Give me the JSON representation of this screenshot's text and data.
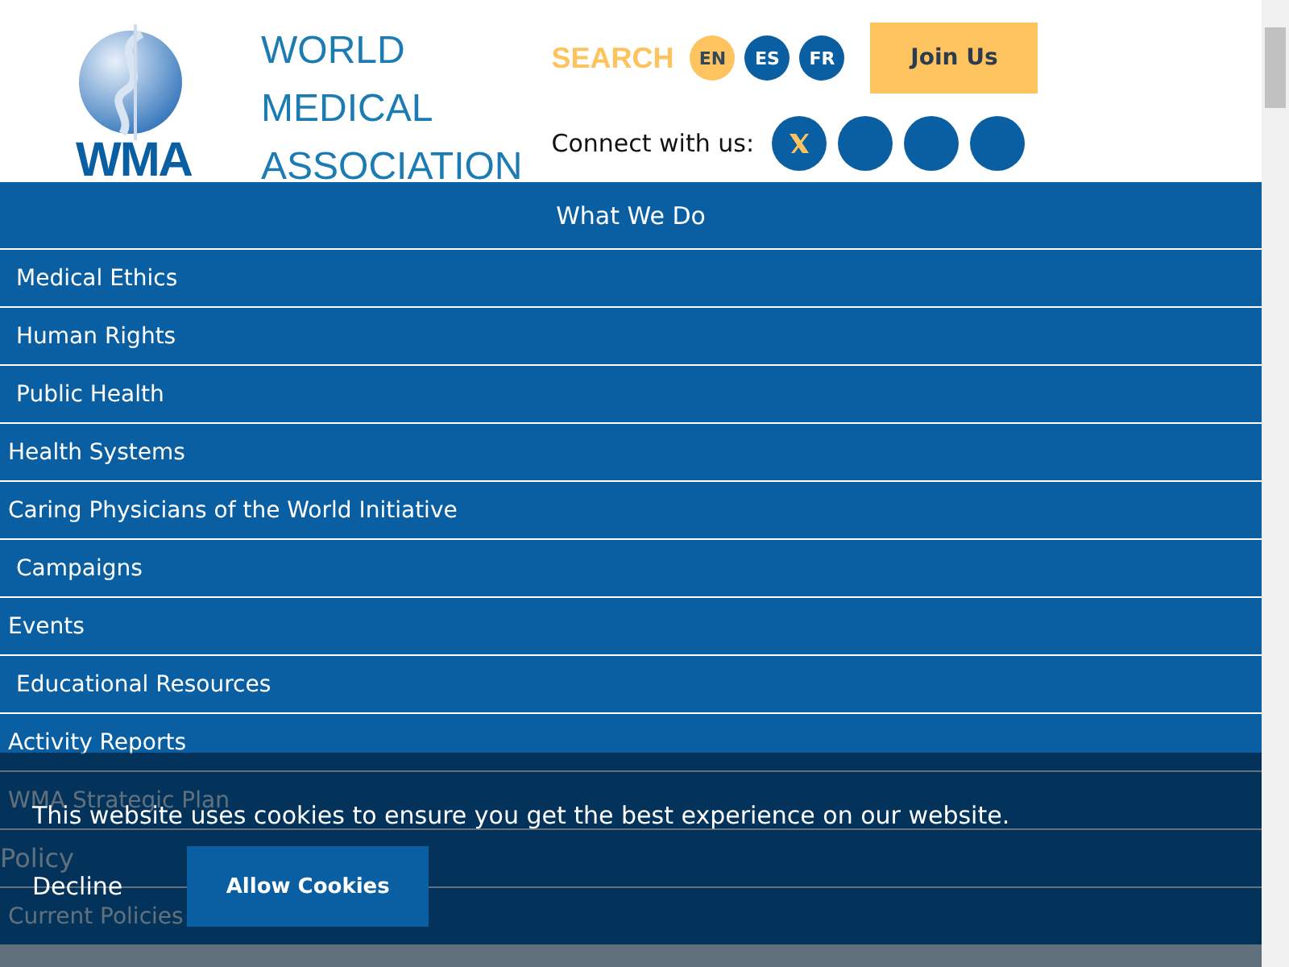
{
  "header": {
    "logo_mark": "WMA",
    "org_name": [
      "WORLD",
      "MEDICAL",
      "ASSOCIATION"
    ],
    "search_label": "SEARCH",
    "languages": [
      {
        "label": "EN",
        "selected": true
      },
      {
        "label": "ES",
        "selected": false
      },
      {
        "label": "FR",
        "selected": false
      }
    ],
    "join_button": "Join Us",
    "connect_label": "Connect with us:",
    "social": [
      {
        "kind": "x"
      },
      {
        "kind": "blank"
      },
      {
        "kind": "blank"
      },
      {
        "kind": "blank"
      }
    ]
  },
  "menu": {
    "title": "What We Do",
    "items": [
      {
        "label": "Medical Ethics",
        "kind": "sub"
      },
      {
        "label": "Human Rights",
        "kind": "sub"
      },
      {
        "label": "Public Health",
        "kind": "sub"
      },
      {
        "label": "Health Systems",
        "kind": "link"
      },
      {
        "label": "Caring Physicians of the World Initiative",
        "kind": "link"
      },
      {
        "label": "Campaigns",
        "kind": "sub"
      },
      {
        "label": "Events",
        "kind": "link"
      },
      {
        "label": "Educational Resources",
        "kind": "sub"
      },
      {
        "label": "Activity Reports",
        "kind": "link"
      },
      {
        "label": "WMA Strategic Plan",
        "kind": "link"
      },
      {
        "label": "Policy",
        "kind": "section"
      },
      {
        "label": "Current Policies",
        "kind": "link"
      }
    ]
  },
  "cookie_banner": {
    "message": "This website uses cookies to ensure you get the best experience on our website.",
    "decline": "Decline",
    "allow": "Allow Cookies"
  }
}
